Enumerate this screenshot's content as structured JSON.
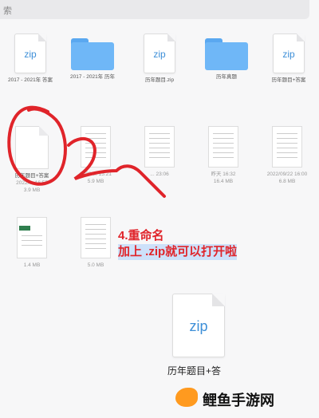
{
  "search": {
    "text": "索"
  },
  "grid": {
    "row1": [
      {
        "type": "zip",
        "label": "zip",
        "name": "2017 - 2021年 答案",
        "meta": ""
      },
      {
        "type": "folder",
        "name": "2017 - 2021年 历年",
        "meta": ""
      },
      {
        "type": "zip",
        "label": "zip",
        "name": "历年题目.zip",
        "meta": ""
      },
      {
        "type": "folder",
        "name": "历年真题",
        "meta": ""
      },
      {
        "type": "zip",
        "label": "zip",
        "name": "历年题目+答案",
        "meta": ""
      }
    ],
    "row2": [
      {
        "type": "blank",
        "name": "历年题目+答案",
        "date": "2022/... 16:55",
        "size": "3.9 MB"
      },
      {
        "type": "doc",
        "name": "",
        "date": "2022/... 15:21",
        "size": "5.9 MB"
      },
      {
        "type": "doc",
        "name": "",
        "date": "... 23:06",
        "size": ""
      },
      {
        "type": "doc",
        "name": "",
        "date": "昨天 16:32",
        "size": "16.4 MB"
      },
      {
        "type": "doc",
        "name": "",
        "date": "2022/09/22 16:00",
        "size": "6.8 MB"
      }
    ],
    "row3": [
      {
        "type": "doc-green",
        "name": "",
        "size": "1.4 MB"
      },
      {
        "type": "doc",
        "name": "",
        "size": "5.0 MB"
      }
    ]
  },
  "annotation": {
    "line1": "4.重命名",
    "line2": "加上 .zip就可以打开啦"
  },
  "highlight_file": {
    "label": "zip",
    "name": "历年题目+答"
  },
  "watermark": {
    "text": "鲤鱼手游网"
  },
  "colors": {
    "annotation": "#e0242a",
    "zip_blue": "#3d8fd8",
    "folder": "#6fb7f7"
  }
}
